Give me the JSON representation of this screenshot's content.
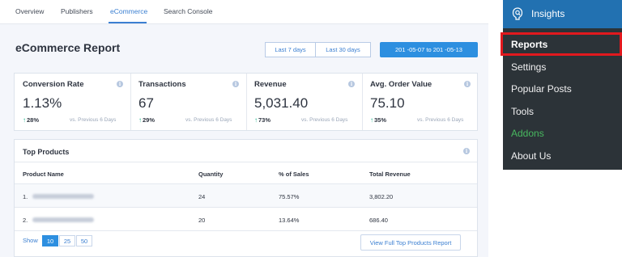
{
  "tabs": [
    {
      "label": "Overview"
    },
    {
      "label": "Publishers"
    },
    {
      "label": "eCommerce"
    },
    {
      "label": "Search Console"
    }
  ],
  "page": {
    "title": "eCommerce Report"
  },
  "date_controls": {
    "last7": "Last 7 days",
    "last30": "Last 30 days",
    "range": "201  -05-07 to 201  -05-13"
  },
  "stats": [
    {
      "label": "Conversion Rate",
      "value": "1.13%",
      "change": "28%",
      "prev": "vs. Previous 6 Days"
    },
    {
      "label": "Transactions",
      "value": "67",
      "change": "29%",
      "prev": "vs. Previous 6 Days"
    },
    {
      "label": "Revenue",
      "value": "5,031.40",
      "change": "73%",
      "prev": "vs. Previous 6 Days"
    },
    {
      "label": "Avg. Order Value",
      "value": "75.10",
      "change": "35%",
      "prev": "vs. Previous 6 Days"
    }
  ],
  "products": {
    "title": "Top Products",
    "columns": [
      "Product Name",
      "Quantity",
      "% of Sales",
      "Total Revenue"
    ],
    "rows": [
      {
        "rank": "1.",
        "quantity": "24",
        "percent": "75.57%",
        "revenue": "3,802.20"
      },
      {
        "rank": "2.",
        "quantity": "20",
        "percent": "13.64%",
        "revenue": "686.40"
      }
    ],
    "show_label": "Show",
    "page_sizes": [
      "10",
      "25",
      "50"
    ],
    "view_full": "View Full Top Products Report"
  },
  "menu": {
    "title": "Insights",
    "items": [
      {
        "label": "Reports"
      },
      {
        "label": "Settings"
      },
      {
        "label": "Popular Posts"
      },
      {
        "label": "Tools"
      },
      {
        "label": "Addons"
      },
      {
        "label": "About Us"
      }
    ]
  },
  "info_glyph": "i",
  "up_arrow": "↑",
  "colors": {
    "accent": "#2d8fe0",
    "positive": "#19b58a",
    "admin_head": "#2271b1",
    "admin_body": "#2c3338",
    "addons": "#48b85f",
    "highlight": "#e2191e"
  }
}
